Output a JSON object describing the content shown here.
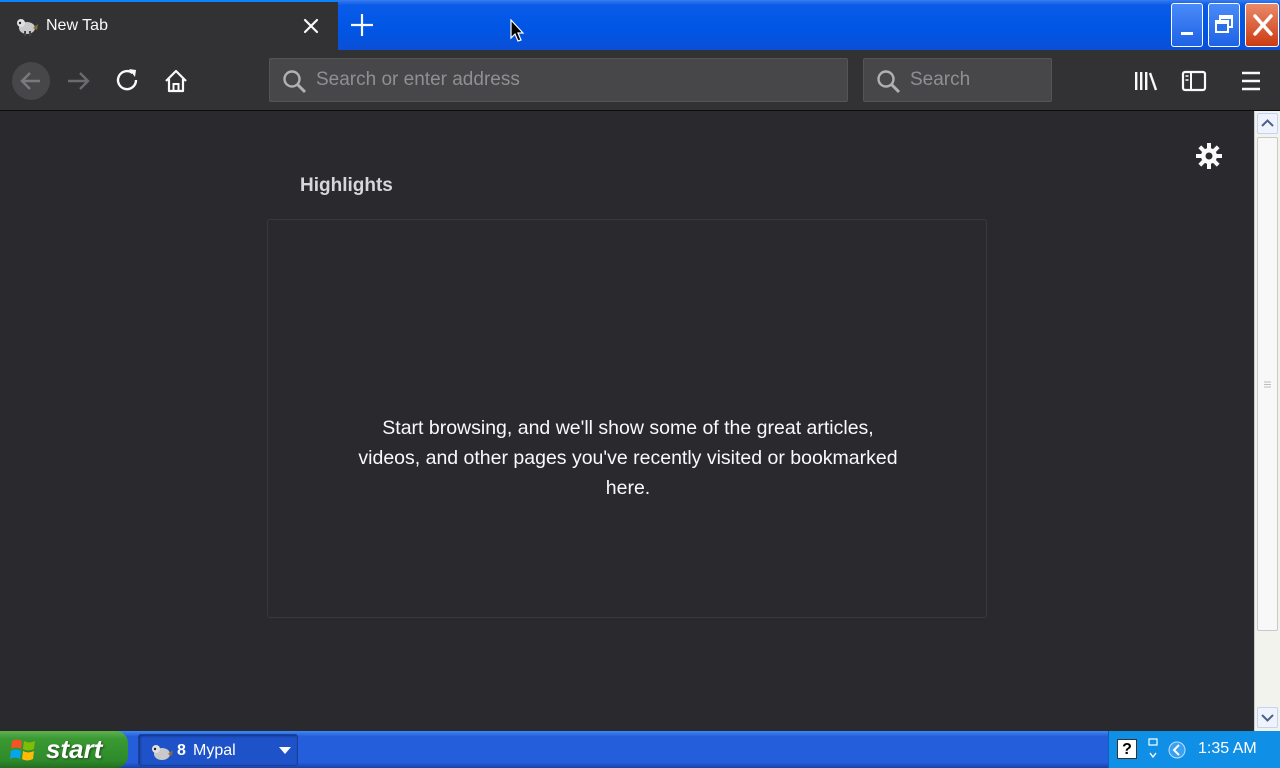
{
  "tab": {
    "title": "New Tab",
    "favicon": "mypal-icon"
  },
  "toolbar": {
    "url_placeholder": "Search or enter address",
    "search_placeholder": "Search"
  },
  "content": {
    "section_title": "Highlights",
    "empty_message": "Start browsing, and we'll show some of the great articles, videos, and other pages you've recently visited or bookmarked here."
  },
  "taskbar": {
    "start_label": "start",
    "task": {
      "count": "8",
      "name": "Mypal"
    },
    "clock": "1:35 AM",
    "help_glyph": "?"
  },
  "colors": {
    "chrome": "#323234",
    "content_bg": "#2a2a2e",
    "xp_blue": "#245edb",
    "xp_green": "#3b9a33"
  }
}
